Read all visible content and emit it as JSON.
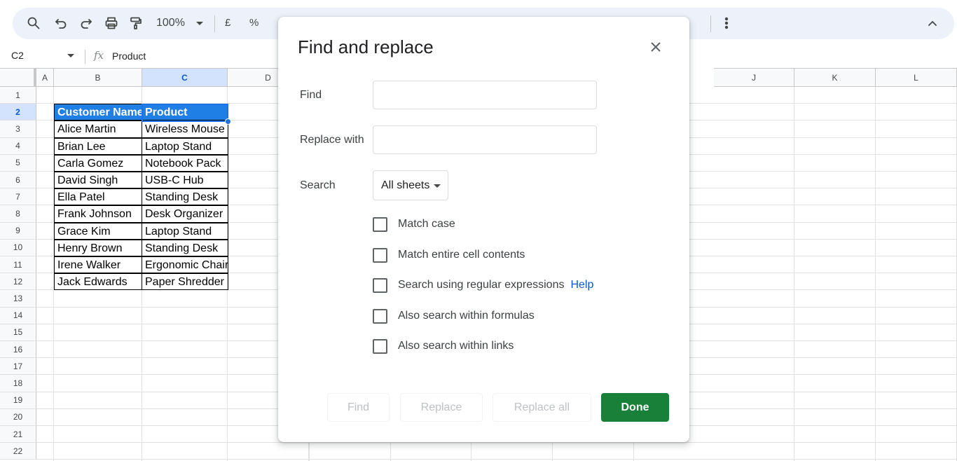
{
  "toolbar": {
    "zoom": "100%",
    "currency_label": "£",
    "percent_label": "%"
  },
  "formula_bar": {
    "name_box": "C2",
    "fx_label": "fx",
    "value": "Product"
  },
  "grid": {
    "columns": [
      "A",
      "B",
      "C",
      "D",
      "J",
      "K",
      "L"
    ],
    "rows": [
      "1",
      "2",
      "3",
      "4",
      "5",
      "6",
      "7",
      "8",
      "9",
      "10",
      "11",
      "12",
      "13",
      "14",
      "15",
      "16",
      "17",
      "18",
      "19",
      "20",
      "21",
      "22"
    ],
    "selected_cell": "C2",
    "header_row": [
      "Customer Name",
      "Product"
    ],
    "data_rows": [
      [
        "Alice Martin",
        "Wireless Mouse"
      ],
      [
        "Brian Lee",
        "Laptop Stand"
      ],
      [
        "Carla Gomez",
        "Notebook Pack"
      ],
      [
        "David Singh",
        "USB-C Hub"
      ],
      [
        "Ella Patel",
        "Standing Desk"
      ],
      [
        "Frank Johnson",
        "Desk Organizer"
      ],
      [
        "Grace Kim",
        "Laptop Stand"
      ],
      [
        "Henry Brown",
        "Standing Desk"
      ],
      [
        "Irene Walker",
        "Ergonomic Chair"
      ],
      [
        "Jack Edwards",
        "Paper Shredder"
      ]
    ]
  },
  "dialog": {
    "title": "Find and replace",
    "find_label": "Find",
    "find_value": "",
    "replace_label": "Replace with",
    "replace_value": "",
    "search_label": "Search",
    "search_scope": "All sheets",
    "options": [
      {
        "label": "Match case",
        "checked": false
      },
      {
        "label": "Match entire cell contents",
        "checked": false
      },
      {
        "label": "Search using regular expressions",
        "checked": false
      },
      {
        "label": "Also search within formulas",
        "checked": false
      },
      {
        "label": "Also search within links",
        "checked": false
      }
    ],
    "help_link": "Help",
    "buttons": {
      "find": "Find",
      "replace": "Replace",
      "replace_all": "Replace all",
      "done": "Done"
    }
  },
  "colors": {
    "header_fill": "#1f7fe5",
    "done_button": "#188038",
    "selection": "#1a73e8"
  }
}
